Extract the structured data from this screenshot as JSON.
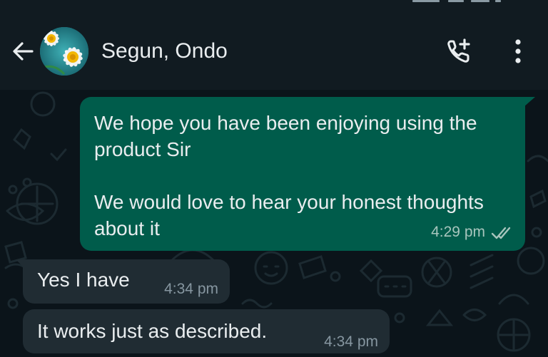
{
  "header": {
    "contact_name": "Segun, Ondo",
    "back_icon": "arrow-left-icon",
    "call_icon": "add-call-icon",
    "menu_icon": "more-vertical-icon",
    "background_color": "#111b21"
  },
  "messages": [
    {
      "direction": "outgoing",
      "text": "We hope you have been enjoying using the product Sir\n\nWe would love to hear your honest thoughts about it",
      "time": "4:29 pm",
      "status": "read",
      "bubble_color": "#005c4b"
    },
    {
      "direction": "incoming",
      "text": "Yes I have",
      "time": "4:34 pm",
      "bubble_color": "#202c33"
    },
    {
      "direction": "incoming",
      "text": "It works just as described.",
      "time": "4:34 pm",
      "bubble_color": "#202c33"
    }
  ],
  "chat": {
    "background_color": "#0b141a",
    "wallpaper": "doodle-pattern"
  }
}
